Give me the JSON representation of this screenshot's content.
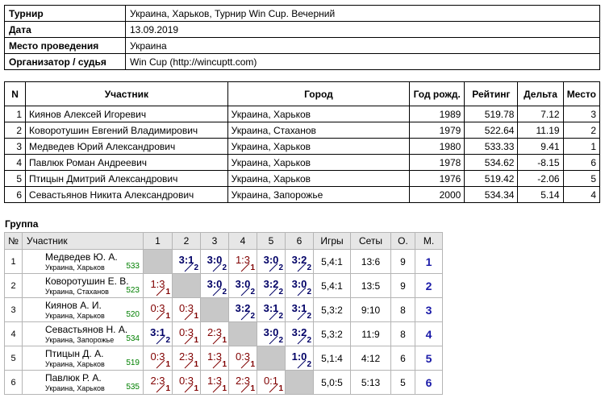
{
  "info": [
    {
      "label": "Турнир",
      "value": "Украина, Харьков, Турнир Win Cup. Вечерний"
    },
    {
      "label": "Дата",
      "value": "13.09.2019"
    },
    {
      "label": "Место проведения",
      "value": "Украина"
    },
    {
      "label": "Организатор / судья",
      "value": "Win Cup (http://wincuptt.com)"
    }
  ],
  "participants": {
    "headers": [
      "N",
      "Участник",
      "Город",
      "Год рожд.",
      "Рейтинг",
      "Дельта",
      "Место"
    ],
    "rows": [
      [
        "1",
        "Киянов Алексей Игоревич",
        "Украина, Харьков",
        "1989",
        "519.78",
        "7.12",
        "3"
      ],
      [
        "2",
        "Коворотушин Евгений Владимирович",
        "Украина, Стаханов",
        "1979",
        "522.64",
        "11.19",
        "2"
      ],
      [
        "3",
        "Медведев Юрий Александрович",
        "Украина, Харьков",
        "1980",
        "533.33",
        "9.41",
        "1"
      ],
      [
        "4",
        "Павлюк Роман Андреевич",
        "Украина, Харьков",
        "1978",
        "534.62",
        "-8.15",
        "6"
      ],
      [
        "5",
        "Птицын Дмитрий Александрович",
        "Украина, Харьков",
        "1976",
        "519.42",
        "-2.06",
        "5"
      ],
      [
        "6",
        "Севастьянов Никита Александрович",
        "Украина, Запорожье",
        "2000",
        "534.34",
        "5.14",
        "4"
      ]
    ]
  },
  "group": {
    "title": "Группа",
    "headers": [
      "№",
      "Участник",
      "1",
      "2",
      "3",
      "4",
      "5",
      "6",
      "Игры",
      "Сеты",
      "О.",
      "М."
    ],
    "rows": [
      {
        "n": "1",
        "name": "Медведев Ю. А.",
        "city": "Украина, Харьков",
        "rating": "533",
        "results": [
          null,
          [
            "3:1",
            "2"
          ],
          [
            "3:0",
            "2"
          ],
          [
            "1:3",
            "1"
          ],
          [
            "3:0",
            "2"
          ],
          [
            "3:2",
            "2"
          ]
        ],
        "games": "5,4:1",
        "sets": "13:6",
        "points": "9",
        "place": "1"
      },
      {
        "n": "2",
        "name": "Коворотушин Е. В.",
        "city": "Украина, Стаханов",
        "rating": "523",
        "results": [
          [
            "1:3",
            "1"
          ],
          null,
          [
            "3:0",
            "2"
          ],
          [
            "3:0",
            "2"
          ],
          [
            "3:2",
            "2"
          ],
          [
            "3:0",
            "2"
          ]
        ],
        "games": "5,4:1",
        "sets": "13:5",
        "points": "9",
        "place": "2"
      },
      {
        "n": "3",
        "name": "Киянов А. И.",
        "city": "Украина, Харьков",
        "rating": "520",
        "results": [
          [
            "0:3",
            "1"
          ],
          [
            "0:3",
            "1"
          ],
          null,
          [
            "3:2",
            "2"
          ],
          [
            "3:1",
            "2"
          ],
          [
            "3:1",
            "2"
          ]
        ],
        "games": "5,3:2",
        "sets": "9:10",
        "points": "8",
        "place": "3"
      },
      {
        "n": "4",
        "name": "Севастьянов Н. А.",
        "city": "Украина, Запорожье",
        "rating": "534",
        "results": [
          [
            "3:1",
            "2"
          ],
          [
            "0:3",
            "1"
          ],
          [
            "2:3",
            "1"
          ],
          null,
          [
            "3:0",
            "2"
          ],
          [
            "3:2",
            "2"
          ]
        ],
        "games": "5,3:2",
        "sets": "11:9",
        "points": "8",
        "place": "4"
      },
      {
        "n": "5",
        "name": "Птицын Д. А.",
        "city": "Украина, Харьков",
        "rating": "519",
        "results": [
          [
            "0:3",
            "1"
          ],
          [
            "2:3",
            "1"
          ],
          [
            "1:3",
            "1"
          ],
          [
            "0:3",
            "1"
          ],
          null,
          [
            "1:0",
            "2"
          ]
        ],
        "games": "5,1:4",
        "sets": "4:12",
        "points": "6",
        "place": "5"
      },
      {
        "n": "6",
        "name": "Павлюк Р. А.",
        "city": "Украина, Харьков",
        "rating": "535",
        "results": [
          [
            "2:3",
            "1"
          ],
          [
            "0:3",
            "1"
          ],
          [
            "1:3",
            "1"
          ],
          [
            "2:3",
            "1"
          ],
          [
            "0:1",
            "1"
          ],
          null
        ],
        "games": "5,0:5",
        "sets": "5:13",
        "points": "5",
        "place": "6"
      }
    ]
  },
  "colors": {
    "win": "#000066",
    "loss": "#800000",
    "rating": "#008000",
    "place": "#1a1aa8",
    "diagonal": "#c8c8c8",
    "header_bg": "#e6e6e6"
  }
}
